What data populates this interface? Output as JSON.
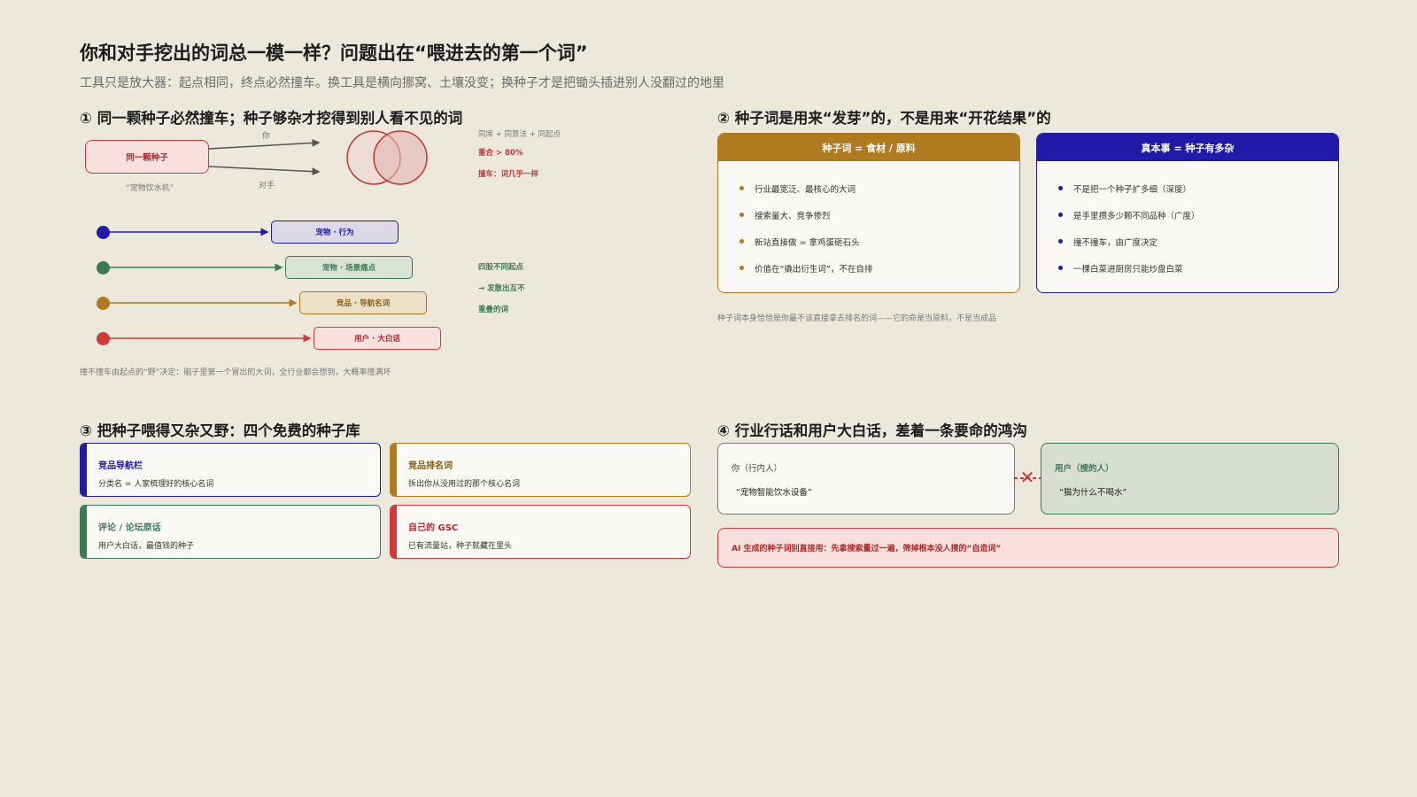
{
  "title": "你和对手挖出的词总一模一样？问题出在“喂进去的第一个词”",
  "subtitle": "工具只是放大器：起点相同，终点必然撞车。换工具是横向挪窝、土壤没变；换种子才是把锄头插进别人没翻过的地里",
  "colors": {
    "red": "#d03a3a",
    "navy": "#1f1aa8",
    "gold": "#b07a1f",
    "green": "#3b7a52"
  },
  "s1": {
    "heading": "① 同一颗种子必然撞车；种子够杂才挖得到别人看不见的词",
    "seed_label": "同一颗种子",
    "seed_caption": "“宠物饮水机”",
    "you": "你",
    "rival": "对手",
    "venn_caption": "同库 + 同算法 + 同起点",
    "overlap": "重合 > 80%",
    "crash": "撞车：词几乎一样",
    "lanes": [
      {
        "label": "宠物 · 行为",
        "color": "#1f1aa8"
      },
      {
        "label": "宠物 · 场景痛点",
        "color": "#3b7a52"
      },
      {
        "label": "竞品 · 导航名词",
        "color": "#b07a1f"
      },
      {
        "label": "用户 · 大白话",
        "color": "#d03a3a"
      }
    ],
    "lanes_note_1": "四股不同起点",
    "lanes_note_2": "→ 发散出互不",
    "lanes_note_3": "重叠的词",
    "footnote": "撞不撞车由起点的“野”决定：脑子里第一个冒出的大词，全行业都会想到，大概率撞满坏"
  },
  "s2": {
    "heading": "② 种子词是用来“发芽”的，不是用来“开花结果”的",
    "left_title": "种子词 = 食材 / 原料",
    "left_items": [
      "行业最宽泛、最核心的大词",
      "搜索量大、竞争惨烈",
      "新站直接做 = 拿鸡蛋砸石头",
      "价值在“撬出衍生词”，不在自排"
    ],
    "right_title": "真本事 = 种子有多杂",
    "right_items": [
      "不是把一个种子扩多细（深度）",
      "是手里攒多少颗不同品种（广度）",
      "撞不撞车，由广度决定",
      "一棵白菜进厨房只能炒盘白菜"
    ],
    "footnote": "种子词本身恰恰是你最不该直接拿去排名的词——它的命是当原料，不是当成品"
  },
  "s3": {
    "heading": "③ 把种子喂得又杂又野：四个免费的种子库",
    "libs": [
      {
        "title": "竞品导航栏",
        "desc": "分类名 = 人家梳理好的核心名词",
        "color": "#1f1aa8"
      },
      {
        "title": "竞品排名词",
        "desc": "拆出你从没用过的那个核心名词",
        "color": "#b07a1f"
      },
      {
        "title": "评论 / 论坛原话",
        "desc": "用户大白话，最值钱的种子",
        "color": "#3b7a52"
      },
      {
        "title": "自己的 GSC",
        "desc": "已有流量站，种子就藏在里头",
        "color": "#d03a3a"
      }
    ]
  },
  "s4": {
    "heading": "④ 行业行话和用户大白话，差着一条要命的鸿沟",
    "you_label": "你（行内人）",
    "you_quote": "“宠物智能饮水设备”",
    "user_label": "用户（搜的人）",
    "user_quote": "“猫为什么不喝水”",
    "gap_icon": "✕",
    "warning": "AI 生成的种子词别直接用：先拿搜索量过一遍，筛掉根本没人搜的“自造词”"
  }
}
